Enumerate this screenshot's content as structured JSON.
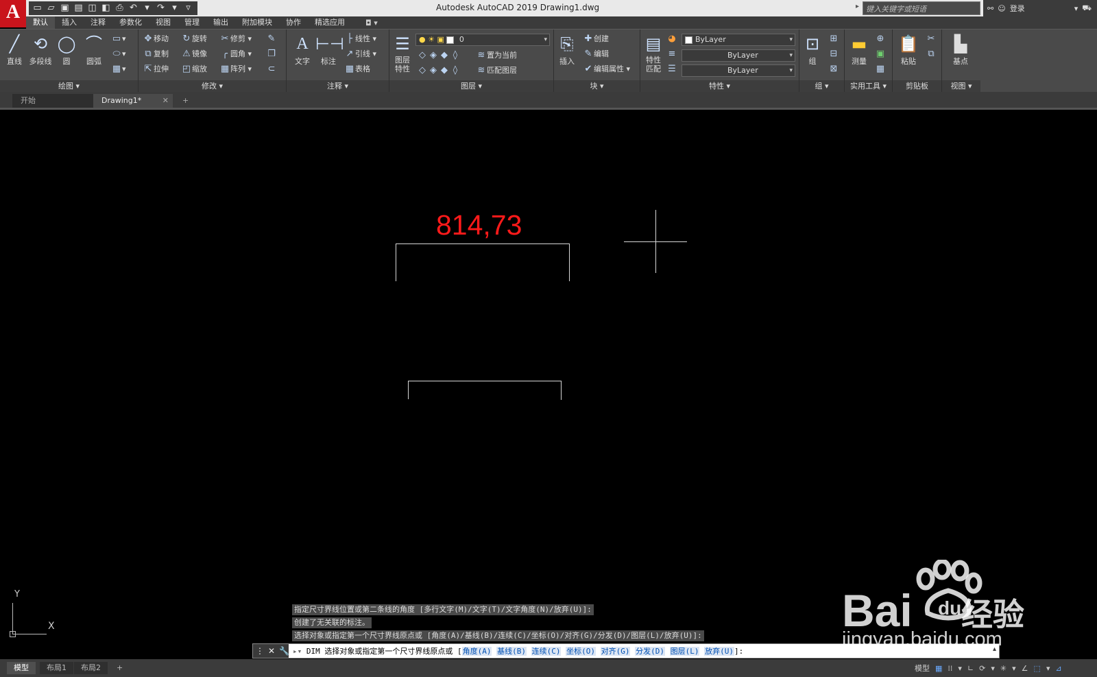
{
  "title_bar": {
    "app_logo": "A",
    "title": "Autodesk AutoCAD 2019    Drawing1.dwg",
    "search_placeholder": "键入关键字或短语",
    "login_label": "登录"
  },
  "menu_tabs": [
    "默认",
    "插入",
    "注释",
    "参数化",
    "视图",
    "管理",
    "输出",
    "附加模块",
    "协作",
    "精选应用"
  ],
  "ribbon": {
    "draw": {
      "title": "绘图",
      "line": "直线",
      "polyline": "多段线",
      "circle": "圆",
      "arc": "圆弧"
    },
    "modify": {
      "title": "修改",
      "move": "移动",
      "rotate": "旋转",
      "trim": "修剪",
      "copy": "复制",
      "mirror": "镜像",
      "fillet": "圆角",
      "stretch": "拉伸",
      "scale": "缩放",
      "array": "阵列"
    },
    "annotation": {
      "title": "注释",
      "text": "文字",
      "dimension": "标注",
      "linear": "线性",
      "leader": "引线",
      "table": "表格"
    },
    "layers": {
      "title": "图层",
      "layer_props": "图层\n特性",
      "layer_value": "0",
      "set_current": "置为当前",
      "match_layer": "匹配图层"
    },
    "block": {
      "title": "块",
      "insert": "插入",
      "create": "创建",
      "edit": "编辑",
      "edit_attr": "编辑属性"
    },
    "properties": {
      "title": "特性",
      "match": "特性\n匹配",
      "color": "ByLayer",
      "linetype": "ByLayer",
      "lineweight": "ByLayer"
    },
    "group": {
      "title": "组",
      "group": "组"
    },
    "utilities": {
      "title": "实用工具",
      "measure": "测量"
    },
    "clipboard": {
      "title": "剪贴板",
      "paste": "粘贴"
    },
    "view": {
      "title": "视图",
      "base": "基点"
    }
  },
  "file_tabs": {
    "start": "开始",
    "drawing": "Drawing1*",
    "add": "+"
  },
  "canvas": {
    "dimension_text": "814,73",
    "ucs_y": "Y",
    "ucs_x": "X"
  },
  "command": {
    "history": [
      "指定尺寸界线位置或第二条线的角度 [多行文字(M)/文字(T)/文字角度(N)/放弃(U)]:",
      "创建了无关联的标注。",
      "选择对象或指定第一个尺寸界线原点或 [角度(A)/基线(B)/连续(C)/坐标(O)/对齐(G)/分发(D)/图层(L)/放弃(U)]:"
    ],
    "prompt_prefix": "DIM 选择对象或指定第一个尺寸界线原点或 [",
    "options": [
      "角度(A)",
      "基线(B)",
      "连续(C)",
      "坐标(O)",
      "对齐(G)",
      "分发(D)",
      "图层(L)",
      "放弃(U)"
    ],
    "prompt_suffix": "]:"
  },
  "layout_tabs": [
    "模型",
    "布局1",
    "布局2",
    "+"
  ],
  "status": {
    "model_label": "模型"
  },
  "watermark": {
    "bai": "Bai",
    "jingyan": "经验",
    "url": "jingyan.baidu.com"
  },
  "colors": {
    "dimension_text": "#ff1a1a",
    "logo": "#c9141c"
  }
}
